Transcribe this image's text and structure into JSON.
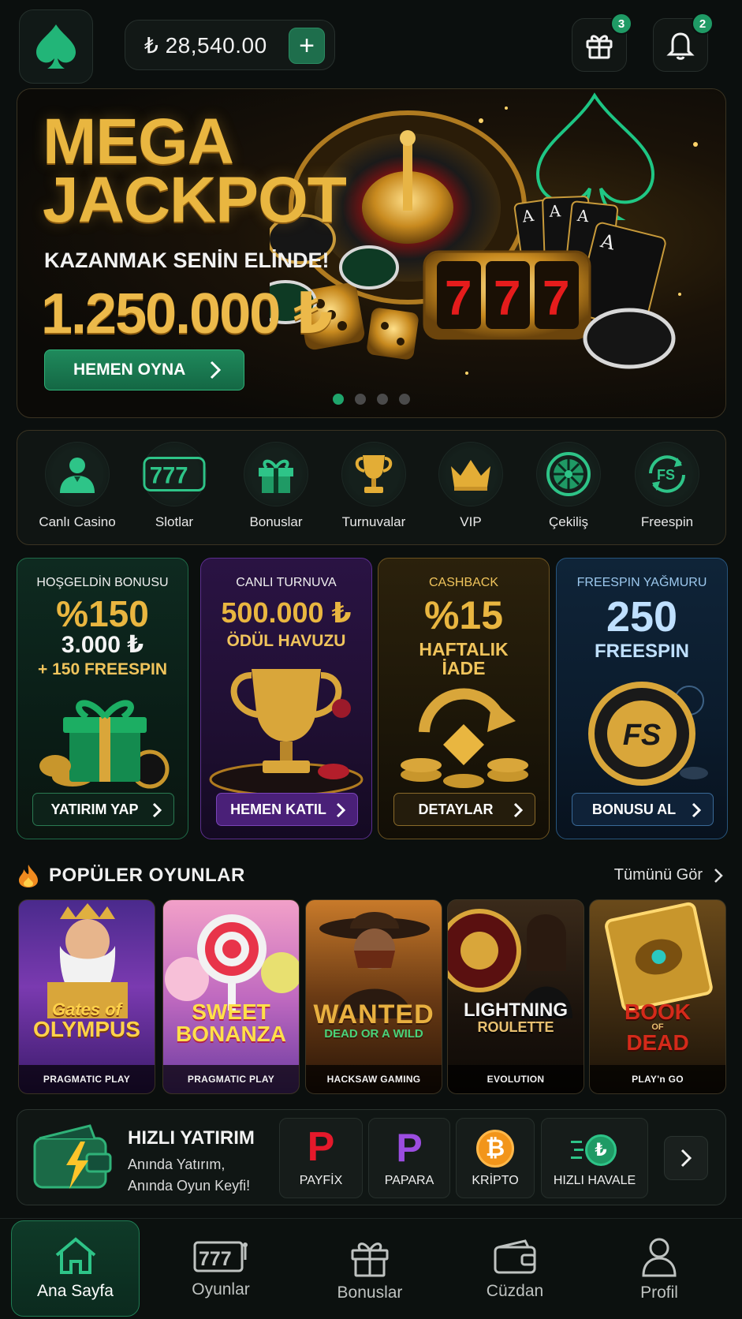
{
  "header": {
    "balance": "₺ 28,540.00",
    "add_funds": "+",
    "gift_badge": "3",
    "notification_badge": "2"
  },
  "hero": {
    "title_line1": "MEGA",
    "title_line2": "JACKPOT",
    "subtitle": "KAZANMAK SENİN ELİNDE!",
    "amount": "1.250.000 ₺",
    "cta": "HEMEN OYNA",
    "slides": 4,
    "active_slide": 1
  },
  "categories": [
    {
      "label": "Canlı Casino",
      "icon": "dealer-icon"
    },
    {
      "label": "Slotlar",
      "icon": "slot-777-icon"
    },
    {
      "label": "Bonuslar",
      "icon": "gift-icon"
    },
    {
      "label": "Turnuvalar",
      "icon": "trophy-icon"
    },
    {
      "label": "VIP",
      "icon": "crown-icon"
    },
    {
      "label": "Çekiliş",
      "icon": "wheel-icon"
    },
    {
      "label": "Freespin",
      "icon": "freespin-icon"
    }
  ],
  "promos": [
    {
      "top": "HOŞGELDİN BONUSU",
      "line1": "%150",
      "line2": "3.000 ₺",
      "line3": "+ 150 FREESPIN",
      "cta": "YATIRIM YAP"
    },
    {
      "top": "CANLI TURNUVA",
      "line1": "500.000 ₺",
      "line2": "ÖDÜL HAVUZU",
      "cta": "HEMEN KATIL"
    },
    {
      "top": "CASHBACK",
      "line1": "%15",
      "line2": "HAFTALIK",
      "line3": "İADE",
      "cta": "DETAYLAR"
    },
    {
      "top": "FREESPIN YAĞMURU",
      "line1": "250",
      "line2": "FREESPIN",
      "art_label": "FS",
      "cta": "BONUSU AL"
    }
  ],
  "popular": {
    "title": "POPÜLER OYUNLAR",
    "see_all": "Tümünü Gör",
    "games": [
      {
        "name1": "Gates of",
        "name2": "OLYMPUS",
        "provider": "PRAGMATIC PLAY"
      },
      {
        "name1": "SWEET",
        "name2": "BONANZA",
        "provider": "PRAGMATIC PLAY"
      },
      {
        "name1": "WANTED",
        "name2": "DEAD OR A WILD",
        "provider": "HACKSAW GAMING"
      },
      {
        "name1": "LIGHTNING",
        "name2": "ROULETTE",
        "provider": "EVOLUTION"
      },
      {
        "name1": "BOOK",
        "name2": "DEAD",
        "name_of": "OF",
        "provider": "PLAY'n GO"
      }
    ]
  },
  "quick_deposit": {
    "title": "HIZLI YATIRIM",
    "line1": "Anında Yatırım,",
    "line2": "Anında Oyun Keyfi!",
    "methods": [
      {
        "label": "PAYFİX",
        "glyph": "P"
      },
      {
        "label": "PAPARA",
        "glyph": "P"
      },
      {
        "label": "KRİPTO",
        "glyph": "₿"
      },
      {
        "label": "HIZLI HAVALE",
        "glyph": "₺"
      }
    ]
  },
  "nav": [
    {
      "label": "Ana Sayfa",
      "active": true
    },
    {
      "label": "Oyunlar"
    },
    {
      "label": "Bonuslar"
    },
    {
      "label": "Cüzdan"
    },
    {
      "label": "Profil"
    }
  ],
  "colors": {
    "accent_green": "#1fa56c",
    "gold": "#e9b640",
    "background": "#0b0f0e"
  }
}
